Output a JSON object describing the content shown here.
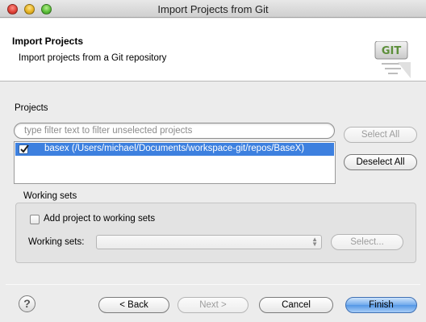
{
  "window": {
    "title": "Import Projects from Git"
  },
  "header": {
    "title": "Import Projects",
    "subtitle": "Import projects from a Git repository",
    "logo_text": "GIT"
  },
  "projects": {
    "label": "Projects",
    "filter_placeholder": "type filter text to filter unselected projects",
    "items": [
      {
        "label": "basex (/Users/michael/Documents/workspace-git/repos/BaseX)",
        "checked": true,
        "selected": true
      }
    ],
    "select_all_label": "Select All",
    "deselect_all_label": "Deselect All"
  },
  "working_sets": {
    "group_label": "Working sets",
    "add_checkbox_label": "Add project to working sets",
    "add_checked": false,
    "field_label": "Working sets:",
    "select_value": "",
    "select_button_label": "Select..."
  },
  "footer": {
    "help_icon": "?",
    "back_label": "< Back",
    "next_label": "Next >",
    "cancel_label": "Cancel",
    "finish_label": "Finish"
  },
  "colors": {
    "selection": "#3d80df",
    "default_button": "#5397e6"
  }
}
